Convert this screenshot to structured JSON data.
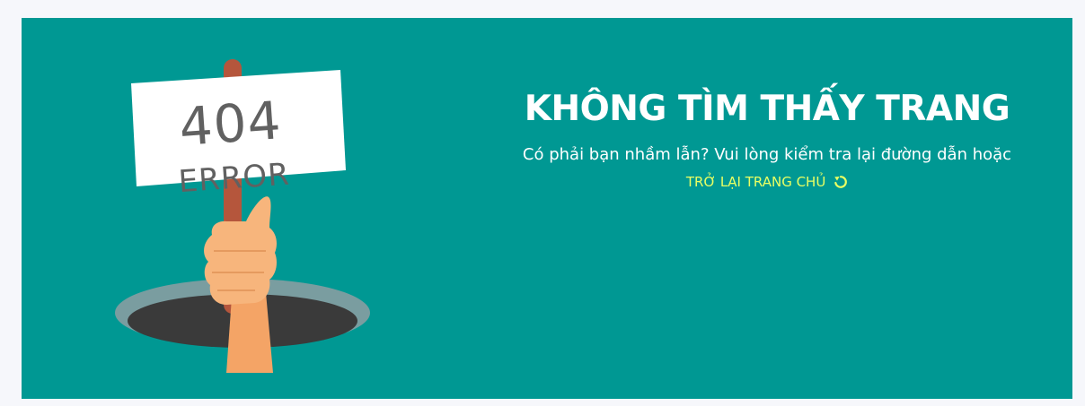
{
  "error_page": {
    "sign": {
      "code": "404",
      "label": "ERROR"
    },
    "title": "KHÔNG TÌM THẤY TRANG",
    "message": "Có phải bạn nhầm lẫn? Vui lòng kiểm tra lại đường dẫn hoặc",
    "home_link": {
      "label": "TRỞ LẠI TRANG CHỦ",
      "icon": "refresh-icon"
    }
  },
  "colors": {
    "background": "#f6f7fb",
    "panel": "#009893",
    "title": "#ffffff",
    "link": "#e9ff63"
  }
}
